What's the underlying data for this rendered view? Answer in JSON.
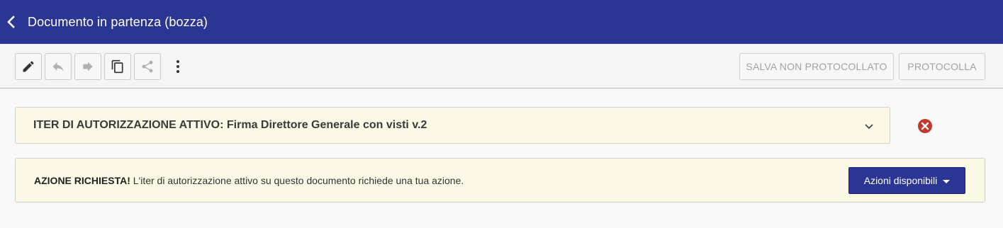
{
  "header": {
    "back_icon": "chevron-left-icon",
    "title": "Documento in partenza (bozza)",
    "color": "#2b3594"
  },
  "toolbar": {
    "icons": [
      "pencil-icon",
      "undo-icon",
      "redo-icon",
      "copy-icon",
      "share-icon",
      "more-vert-icon"
    ],
    "save_label": "SALVA NON PROTOCOLLATO",
    "register_label": "PROTOCOLLA"
  },
  "iter": {
    "label_prefix": "ITER DI AUTORIZZAZIONE ATTIVO:",
    "label_value": "Firma Direttore Generale con visti v.2",
    "expand_icon": "chevron-down-icon",
    "remove_icon": "close-circle-icon",
    "remove_color": "#c0392b"
  },
  "action_required": {
    "bold": "AZIONE RICHIESTA!",
    "text": "L'iter di autorizzazione attivo su questo documento richiede una tua azione.",
    "button_label": "Azioni disponibili",
    "button_icon": "caret-down-icon"
  }
}
